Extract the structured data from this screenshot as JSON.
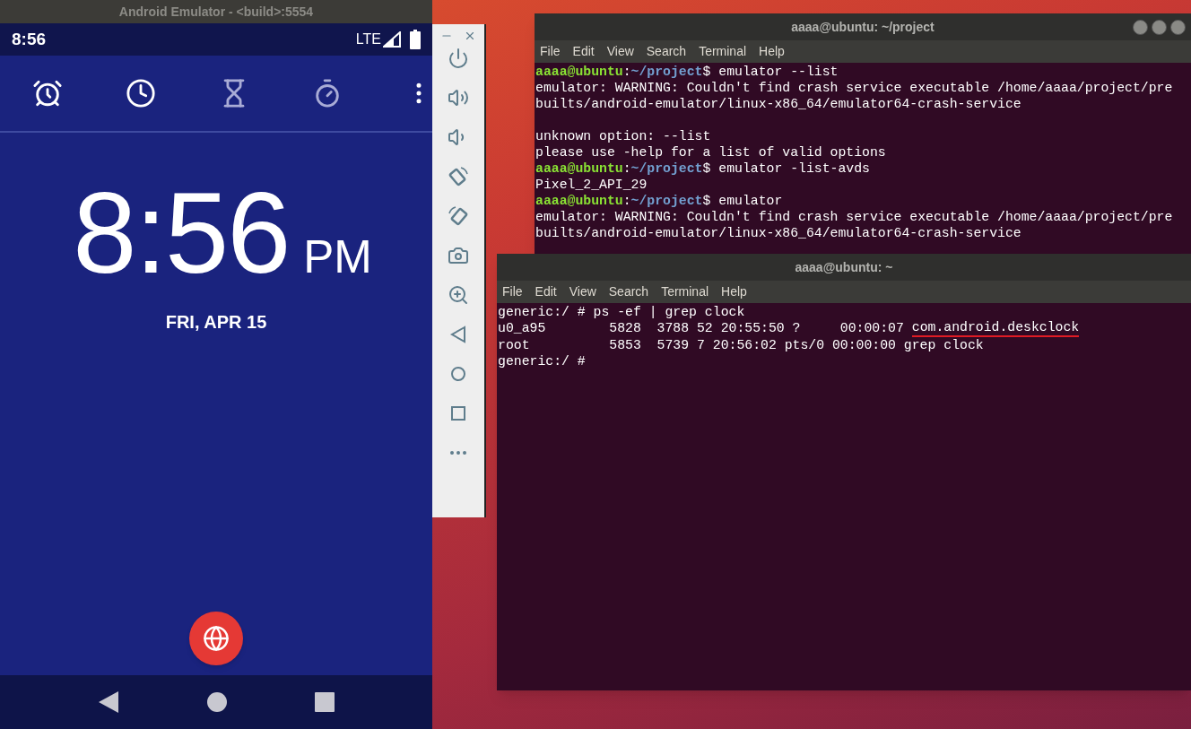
{
  "emulator": {
    "title": "Android Emulator - <build>:5554",
    "status_bar": {
      "time": "8:56",
      "network": "LTE"
    },
    "tabs": [
      {
        "kind": "alarm",
        "dimmed": false
      },
      {
        "kind": "clock",
        "dimmed": false
      },
      {
        "kind": "timer",
        "dimmed": true
      },
      {
        "kind": "stopwatch",
        "dimmed": true
      }
    ],
    "clock": {
      "time": "8:56",
      "period": "PM",
      "date": "FRI, APR 15"
    }
  },
  "terminals": [
    {
      "title": "aaaa@ubuntu: ~/project",
      "window_buttons": true,
      "menu": [
        "File",
        "Edit",
        "View",
        "Search",
        "Terminal",
        "Help"
      ],
      "lines": [
        {
          "kind": "prompt",
          "user": "aaaa@ubuntu",
          "separator": ":",
          "path": "~/project",
          "symbol": "$",
          "command": " emulator --list"
        },
        {
          "kind": "output",
          "text": "emulator: WARNING: Couldn't find crash service executable /home/aaaa/project/pre"
        },
        {
          "kind": "output",
          "text": "builts/android-emulator/linux-x86_64/emulator64-crash-service"
        },
        {
          "kind": "blank"
        },
        {
          "kind": "output",
          "text": "unknown option: --list"
        },
        {
          "kind": "output",
          "text": "please use -help for a list of valid options"
        },
        {
          "kind": "prompt",
          "user": "aaaa@ubuntu",
          "separator": ":",
          "path": "~/project",
          "symbol": "$",
          "command": " emulator -list-avds"
        },
        {
          "kind": "output",
          "text": "Pixel_2_API_29"
        },
        {
          "kind": "prompt",
          "user": "aaaa@ubuntu",
          "separator": ":",
          "path": "~/project",
          "symbol": "$",
          "command": " emulator"
        },
        {
          "kind": "output",
          "text": "emulator: WARNING: Couldn't find crash service executable /home/aaaa/project/pre"
        },
        {
          "kind": "output",
          "text": "builts/android-emulator/linux-x86_64/emulator64-crash-service"
        }
      ]
    },
    {
      "title": "aaaa@ubuntu: ~",
      "window_buttons": false,
      "menu": [
        "File",
        "Edit",
        "View",
        "Search",
        "Terminal",
        "Help"
      ],
      "lines": [
        {
          "kind": "output",
          "text": "generic:/ # ps -ef | grep clock"
        },
        {
          "kind": "output",
          "text": "u0_a95        5828  3788 52 20:55:50 ?     00:00:07 ",
          "highlight": "com.android.deskclock"
        },
        {
          "kind": "output",
          "text": "root          5853  5739 7 20:56:02 pts/0 00:00:00 grep clock"
        },
        {
          "kind": "output",
          "text": "generic:/ #"
        }
      ]
    }
  ]
}
